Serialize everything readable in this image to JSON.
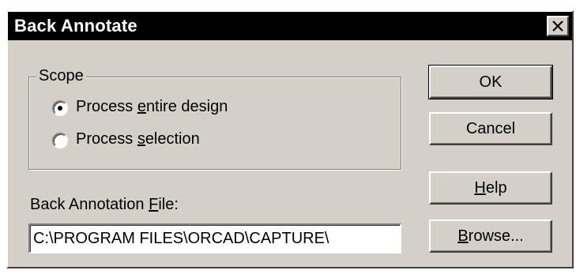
{
  "window": {
    "title": "Back Annotate",
    "close_glyph": "✕"
  },
  "scope": {
    "label": "Scope",
    "options": [
      {
        "pre": "Process ",
        "mnemonic": "e",
        "post": "ntire design",
        "selected": true
      },
      {
        "pre": "Process ",
        "mnemonic": "s",
        "post": "election",
        "selected": false
      }
    ]
  },
  "file": {
    "label_pre": "Back Annotation ",
    "label_mnemonic": "F",
    "label_post": "ile:",
    "value": "C:\\PROGRAM FILES\\ORCAD\\CAPTURE\\"
  },
  "buttons": {
    "ok": "OK",
    "cancel": "Cancel",
    "help_mnemonic": "H",
    "help_rest": "elp",
    "browse_mnemonic": "B",
    "browse_rest": "rowse..."
  },
  "colors": {
    "face": "#d4d0c8",
    "titlebar": "#000000",
    "title_text": "#ffffff"
  },
  "icons": {
    "close": "close-icon",
    "radio_checked": "radio-checked-icon",
    "radio_unchecked": "radio-unchecked-icon"
  }
}
